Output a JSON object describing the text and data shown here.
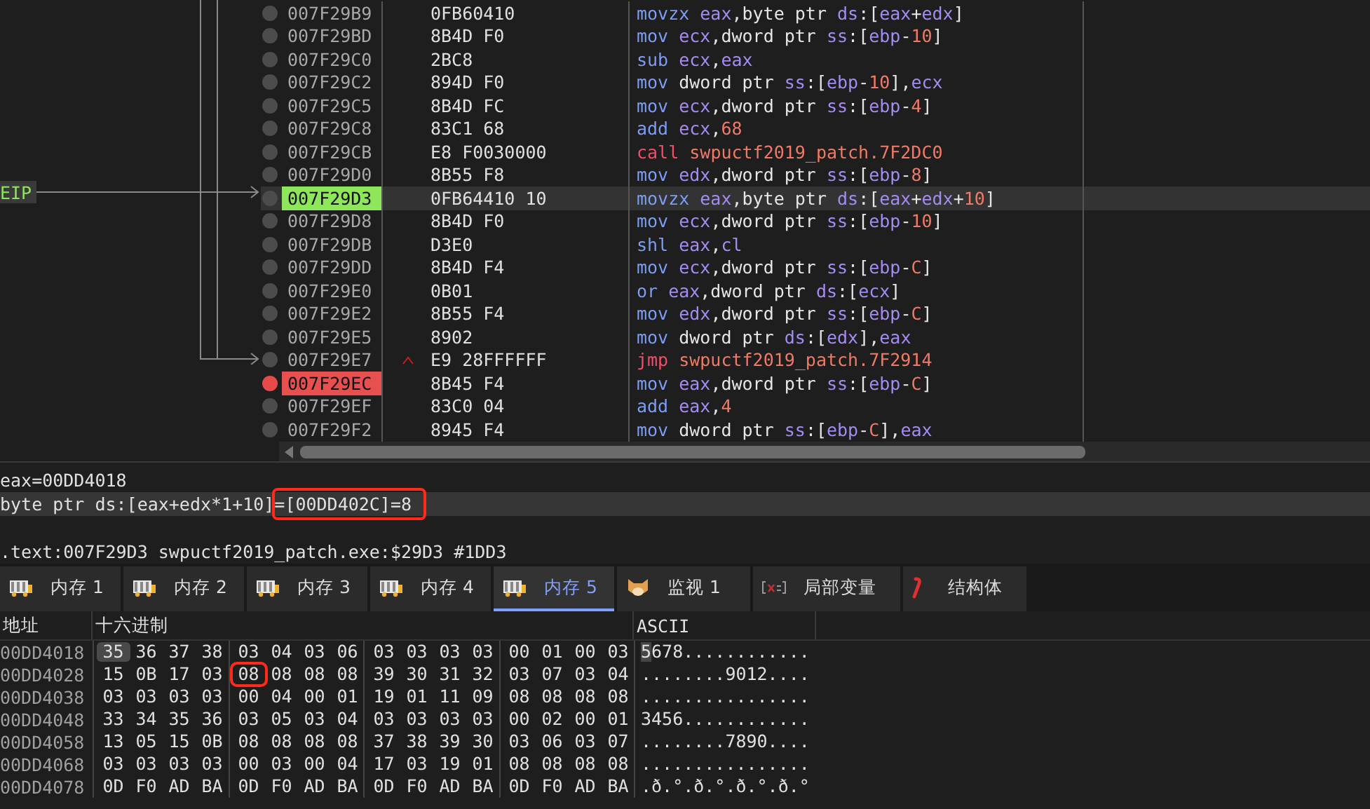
{
  "disassembly": {
    "eip_label": "EIP",
    "rows": [
      {
        "address": "007F29B9",
        "bytes": "0FB60410",
        "eip": false,
        "breakpoint": false,
        "instr": [
          {
            "kind": "op",
            "text": "movzx "
          },
          {
            "kind": "reg",
            "text": "eax"
          },
          {
            "kind": "plain",
            "text": ",byte ptr "
          },
          {
            "kind": "reg",
            "text": "ds"
          },
          {
            "kind": "plain",
            "text": ":["
          },
          {
            "kind": "reg",
            "text": "eax"
          },
          {
            "kind": "plain",
            "text": "+"
          },
          {
            "kind": "reg",
            "text": "edx"
          },
          {
            "kind": "plain",
            "text": "]"
          }
        ]
      },
      {
        "address": "007F29BD",
        "bytes": "8B4D F0",
        "eip": false,
        "breakpoint": false,
        "instr": [
          {
            "kind": "op",
            "text": "mov "
          },
          {
            "kind": "reg",
            "text": "ecx"
          },
          {
            "kind": "plain",
            "text": ",dword ptr "
          },
          {
            "kind": "reg",
            "text": "ss"
          },
          {
            "kind": "plain",
            "text": ":["
          },
          {
            "kind": "reg",
            "text": "ebp"
          },
          {
            "kind": "plain",
            "text": "-"
          },
          {
            "kind": "num",
            "text": "10"
          },
          {
            "kind": "plain",
            "text": "]"
          }
        ]
      },
      {
        "address": "007F29C0",
        "bytes": "2BC8",
        "eip": false,
        "breakpoint": false,
        "instr": [
          {
            "kind": "op",
            "text": "sub "
          },
          {
            "kind": "reg",
            "text": "ecx"
          },
          {
            "kind": "plain",
            "text": ","
          },
          {
            "kind": "reg",
            "text": "eax"
          }
        ]
      },
      {
        "address": "007F29C2",
        "bytes": "894D F0",
        "eip": false,
        "breakpoint": false,
        "instr": [
          {
            "kind": "op",
            "text": "mov "
          },
          {
            "kind": "plain",
            "text": "dword ptr "
          },
          {
            "kind": "reg",
            "text": "ss"
          },
          {
            "kind": "plain",
            "text": ":["
          },
          {
            "kind": "reg",
            "text": "ebp"
          },
          {
            "kind": "plain",
            "text": "-"
          },
          {
            "kind": "num",
            "text": "10"
          },
          {
            "kind": "plain",
            "text": "],"
          },
          {
            "kind": "reg",
            "text": "ecx"
          }
        ]
      },
      {
        "address": "007F29C5",
        "bytes": "8B4D FC",
        "eip": false,
        "breakpoint": false,
        "instr": [
          {
            "kind": "op",
            "text": "mov "
          },
          {
            "kind": "reg",
            "text": "ecx"
          },
          {
            "kind": "plain",
            "text": ",dword ptr "
          },
          {
            "kind": "reg",
            "text": "ss"
          },
          {
            "kind": "plain",
            "text": ":["
          },
          {
            "kind": "reg",
            "text": "ebp"
          },
          {
            "kind": "plain",
            "text": "-"
          },
          {
            "kind": "num",
            "text": "4"
          },
          {
            "kind": "plain",
            "text": "]"
          }
        ]
      },
      {
        "address": "007F29C8",
        "bytes": "83C1 68",
        "eip": false,
        "breakpoint": false,
        "instr": [
          {
            "kind": "op",
            "text": "add "
          },
          {
            "kind": "reg",
            "text": "ecx"
          },
          {
            "kind": "plain",
            "text": ","
          },
          {
            "kind": "num",
            "text": "68"
          }
        ]
      },
      {
        "address": "007F29CB",
        "bytes": "E8 F0030000",
        "eip": false,
        "breakpoint": false,
        "instr": [
          {
            "kind": "branch",
            "text": "call "
          },
          {
            "kind": "num",
            "text": "swpuctf2019_patch.7F2DC0"
          }
        ]
      },
      {
        "address": "007F29D0",
        "bytes": "8B55 F8",
        "eip": false,
        "breakpoint": false,
        "instr": [
          {
            "kind": "op",
            "text": "mov "
          },
          {
            "kind": "reg",
            "text": "edx"
          },
          {
            "kind": "plain",
            "text": ",dword ptr "
          },
          {
            "kind": "reg",
            "text": "ss"
          },
          {
            "kind": "plain",
            "text": ":["
          },
          {
            "kind": "reg",
            "text": "ebp"
          },
          {
            "kind": "plain",
            "text": "-"
          },
          {
            "kind": "num",
            "text": "8"
          },
          {
            "kind": "plain",
            "text": "]"
          }
        ]
      },
      {
        "address": "007F29D3",
        "bytes": "0FB64410 10",
        "eip": true,
        "breakpoint": false,
        "instr": [
          {
            "kind": "op",
            "text": "movzx "
          },
          {
            "kind": "reg",
            "text": "eax"
          },
          {
            "kind": "plain",
            "text": ",byte ptr "
          },
          {
            "kind": "reg",
            "text": "ds"
          },
          {
            "kind": "plain",
            "text": ":["
          },
          {
            "kind": "reg",
            "text": "eax"
          },
          {
            "kind": "plain",
            "text": "+"
          },
          {
            "kind": "reg",
            "text": "edx"
          },
          {
            "kind": "plain",
            "text": "+"
          },
          {
            "kind": "num",
            "text": "10"
          },
          {
            "kind": "plain",
            "text": "]"
          }
        ]
      },
      {
        "address": "007F29D8",
        "bytes": "8B4D F0",
        "eip": false,
        "breakpoint": false,
        "instr": [
          {
            "kind": "op",
            "text": "mov "
          },
          {
            "kind": "reg",
            "text": "ecx"
          },
          {
            "kind": "plain",
            "text": ",dword ptr "
          },
          {
            "kind": "reg",
            "text": "ss"
          },
          {
            "kind": "plain",
            "text": ":["
          },
          {
            "kind": "reg",
            "text": "ebp"
          },
          {
            "kind": "plain",
            "text": "-"
          },
          {
            "kind": "num",
            "text": "10"
          },
          {
            "kind": "plain",
            "text": "]"
          }
        ]
      },
      {
        "address": "007F29DB",
        "bytes": "D3E0",
        "eip": false,
        "breakpoint": false,
        "instr": [
          {
            "kind": "op",
            "text": "shl "
          },
          {
            "kind": "reg",
            "text": "eax"
          },
          {
            "kind": "plain",
            "text": ","
          },
          {
            "kind": "reg",
            "text": "cl"
          }
        ]
      },
      {
        "address": "007F29DD",
        "bytes": "8B4D F4",
        "eip": false,
        "breakpoint": false,
        "instr": [
          {
            "kind": "op",
            "text": "mov "
          },
          {
            "kind": "reg",
            "text": "ecx"
          },
          {
            "kind": "plain",
            "text": ",dword ptr "
          },
          {
            "kind": "reg",
            "text": "ss"
          },
          {
            "kind": "plain",
            "text": ":["
          },
          {
            "kind": "reg",
            "text": "ebp"
          },
          {
            "kind": "plain",
            "text": "-"
          },
          {
            "kind": "num",
            "text": "C"
          },
          {
            "kind": "plain",
            "text": "]"
          }
        ]
      },
      {
        "address": "007F29E0",
        "bytes": "0B01",
        "eip": false,
        "breakpoint": false,
        "instr": [
          {
            "kind": "op",
            "text": "or "
          },
          {
            "kind": "reg",
            "text": "eax"
          },
          {
            "kind": "plain",
            "text": ",dword ptr "
          },
          {
            "kind": "reg",
            "text": "ds"
          },
          {
            "kind": "plain",
            "text": ":["
          },
          {
            "kind": "reg",
            "text": "ecx"
          },
          {
            "kind": "plain",
            "text": "]"
          }
        ]
      },
      {
        "address": "007F29E2",
        "bytes": "8B55 F4",
        "eip": false,
        "breakpoint": false,
        "instr": [
          {
            "kind": "op",
            "text": "mov "
          },
          {
            "kind": "reg",
            "text": "edx"
          },
          {
            "kind": "plain",
            "text": ",dword ptr "
          },
          {
            "kind": "reg",
            "text": "ss"
          },
          {
            "kind": "plain",
            "text": ":["
          },
          {
            "kind": "reg",
            "text": "ebp"
          },
          {
            "kind": "plain",
            "text": "-"
          },
          {
            "kind": "num",
            "text": "C"
          },
          {
            "kind": "plain",
            "text": "]"
          }
        ]
      },
      {
        "address": "007F29E5",
        "bytes": "8902",
        "eip": false,
        "breakpoint": false,
        "instr": [
          {
            "kind": "op",
            "text": "mov "
          },
          {
            "kind": "plain",
            "text": "dword ptr "
          },
          {
            "kind": "reg",
            "text": "ds"
          },
          {
            "kind": "plain",
            "text": ":["
          },
          {
            "kind": "reg",
            "text": "edx"
          },
          {
            "kind": "plain",
            "text": "],"
          },
          {
            "kind": "reg",
            "text": "eax"
          }
        ]
      },
      {
        "address": "007F29E7",
        "bytes": "E9 28FFFFFF",
        "eip": false,
        "breakpoint": false,
        "jump_up": true,
        "instr": [
          {
            "kind": "branch",
            "text": "jmp "
          },
          {
            "kind": "num",
            "text": "swpuctf2019_patch.7F2914"
          }
        ]
      },
      {
        "address": "007F29EC",
        "bytes": "8B45 F4",
        "eip": false,
        "breakpoint": true,
        "instr": [
          {
            "kind": "op",
            "text": "mov "
          },
          {
            "kind": "reg",
            "text": "eax"
          },
          {
            "kind": "plain",
            "text": ",dword ptr "
          },
          {
            "kind": "reg",
            "text": "ss"
          },
          {
            "kind": "plain",
            "text": ":["
          },
          {
            "kind": "reg",
            "text": "ebp"
          },
          {
            "kind": "plain",
            "text": "-"
          },
          {
            "kind": "num",
            "text": "C"
          },
          {
            "kind": "plain",
            "text": "]"
          }
        ]
      },
      {
        "address": "007F29EF",
        "bytes": "83C0 04",
        "eip": false,
        "breakpoint": false,
        "instr": [
          {
            "kind": "op",
            "text": "add "
          },
          {
            "kind": "reg",
            "text": "eax"
          },
          {
            "kind": "plain",
            "text": ","
          },
          {
            "kind": "num",
            "text": "4"
          }
        ]
      },
      {
        "address": "007F29F2",
        "bytes": "8945 F4",
        "eip": false,
        "breakpoint": false,
        "instr": [
          {
            "kind": "op",
            "text": "mov "
          },
          {
            "kind": "plain",
            "text": "dword ptr "
          },
          {
            "kind": "reg",
            "text": "ss"
          },
          {
            "kind": "plain",
            "text": ":["
          },
          {
            "kind": "reg",
            "text": "ebp"
          },
          {
            "kind": "plain",
            "text": "-"
          },
          {
            "kind": "num",
            "text": "C"
          },
          {
            "kind": "plain",
            "text": "],"
          },
          {
            "kind": "reg",
            "text": "eax"
          }
        ]
      }
    ]
  },
  "info": {
    "register_line": "eax=00DD4018",
    "operand": "byte ptr ds:[eax+edx*1+10]",
    "operand_value": "=[00DD402C]=8",
    "operand_value_boxed": true,
    "location": ".text:007F29D3 swpuctf2019_patch.exe:$29D3 #1DD3"
  },
  "tabs": [
    {
      "label": "内存 1",
      "kind": "memory",
      "selected": false
    },
    {
      "label": "内存 2",
      "kind": "memory",
      "selected": false
    },
    {
      "label": "内存 3",
      "kind": "memory",
      "selected": false
    },
    {
      "label": "内存 4",
      "kind": "memory",
      "selected": false
    },
    {
      "label": "内存 5",
      "kind": "memory",
      "selected": true
    },
    {
      "label": "监视 1",
      "kind": "watch",
      "selected": false
    },
    {
      "label": "局部变量",
      "kind": "locals",
      "selected": false
    },
    {
      "label": "结构体",
      "kind": "struct",
      "selected": false
    }
  ],
  "dump": {
    "columns": [
      "地址",
      "十六进制",
      "ASCII"
    ],
    "rows": [
      {
        "address": "00DD4018",
        "ascii_cursor": true,
        "ascii": "5678............",
        "bytes": [
          {
            "v": "35",
            "cursor": true,
            "boxed": false
          },
          "36",
          "37",
          "38",
          "03",
          "04",
          "03",
          "06",
          "03",
          "03",
          "03",
          "03",
          "00",
          "01",
          "00",
          "03"
        ]
      },
      {
        "address": "00DD4028",
        "ascii": "........9012....",
        "bytes": [
          "15",
          "0B",
          "17",
          "03",
          {
            "v": "08",
            "cursor": false,
            "boxed": true
          },
          "08",
          "08",
          "08",
          "39",
          "30",
          "31",
          "32",
          "03",
          "07",
          "03",
          "04"
        ]
      },
      {
        "address": "00DD4038",
        "ascii": "................",
        "bytes": [
          "03",
          "03",
          "03",
          "03",
          "00",
          "04",
          "00",
          "01",
          "19",
          "01",
          "11",
          "09",
          "08",
          "08",
          "08",
          "08"
        ]
      },
      {
        "address": "00DD4048",
        "ascii": "3456............",
        "bytes": [
          "33",
          "34",
          "35",
          "36",
          "03",
          "05",
          "03",
          "04",
          "03",
          "03",
          "03",
          "03",
          "00",
          "02",
          "00",
          "01"
        ]
      },
      {
        "address": "00DD4058",
        "ascii": "........7890....",
        "bytes": [
          "13",
          "05",
          "15",
          "0B",
          "08",
          "08",
          "08",
          "08",
          "37",
          "38",
          "39",
          "30",
          "03",
          "06",
          "03",
          "07"
        ]
      },
      {
        "address": "00DD4068",
        "ascii": "................",
        "bytes": [
          "03",
          "03",
          "03",
          "03",
          "00",
          "03",
          "00",
          "04",
          "17",
          "03",
          "19",
          "01",
          "08",
          "08",
          "08",
          "08"
        ]
      },
      {
        "address": "00DD4078",
        "ascii": ".ð.°.ð.°.ð.°.ð.°",
        "bytes": [
          "0D",
          "F0",
          "AD",
          "BA",
          "0D",
          "F0",
          "AD",
          "BA",
          "0D",
          "F0",
          "AD",
          "BA",
          "0D",
          "F0",
          "AD",
          "BA"
        ]
      }
    ]
  }
}
